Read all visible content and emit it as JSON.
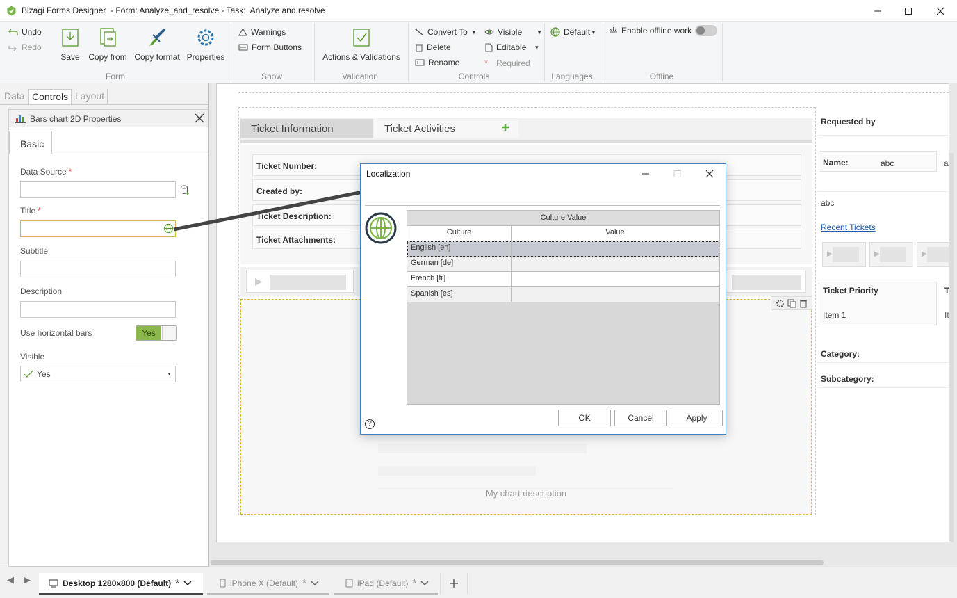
{
  "window": {
    "title": "Bizagi Forms Designer  - Form: Analyze_and_resolve - Task:  Analyze and resolve"
  },
  "ribbon": {
    "undo": "Undo",
    "redo": "Redo",
    "save": "Save",
    "copy_from": "Copy from",
    "copy_format": "Copy format",
    "properties": "Properties",
    "form_group": "Form",
    "warnings": "Warnings",
    "form_buttons": "Form Buttons",
    "show_group": "Show",
    "actions_validations": "Actions & Validations",
    "validation_group": "Validation",
    "convert_to": "Convert To",
    "delete": "Delete",
    "rename": "Rename",
    "visible": "Visible",
    "editable": "Editable",
    "required": "Required",
    "controls_group": "Controls",
    "language_default": "Default",
    "languages_group": "Languages",
    "enable_offline": "Enable offline work",
    "offline_group": "Offline"
  },
  "left_tabs": [
    "Data",
    "Controls",
    "Layout"
  ],
  "properties_panel": {
    "title": "Bars chart 2D Properties",
    "tab": "Basic",
    "data_source_label": "Data Source",
    "title_label": "Title",
    "subtitle_label": "Subtitle",
    "description_label": "Description",
    "horizontal_bars_label": "Use horizontal bars",
    "horizontal_bars_value": "Yes",
    "visible_label": "Visible",
    "visible_value": "Yes"
  },
  "form": {
    "tab_info": "Ticket Information",
    "tab_activities": "Ticket Activities",
    "ticket_number": "Ticket Number:",
    "created_by": "Created by:",
    "ticket_description": "Ticket Description:",
    "ticket_attachments": "Ticket Attachments:",
    "chart_description": "My chart description"
  },
  "right_column": {
    "requested_by": "Requested by",
    "name_label": "Name:",
    "name_value": "abc",
    "name_value_2": "a",
    "abc": "abc",
    "recent_tickets": "Recent Tickets",
    "ticket_priority": "Ticket Priority",
    "priority_item": "Item 1",
    "t_cut": "T",
    "it_cut": "It",
    "category": "Category:",
    "subcategory": "Subcategory:"
  },
  "dialog": {
    "title": "Localization",
    "grid_header": "Culture Value",
    "col_culture": "Culture",
    "col_value": "Value",
    "rows": [
      {
        "culture": "English [en]",
        "value": ""
      },
      {
        "culture": "German [de]",
        "value": ""
      },
      {
        "culture": "French [fr]",
        "value": ""
      },
      {
        "culture": "Spanish [es]",
        "value": ""
      }
    ],
    "ok": "OK",
    "cancel": "Cancel",
    "apply": "Apply",
    "help": "?"
  },
  "bottom_tabs": [
    {
      "label": "Desktop 1280x800 (Default)",
      "star": "*"
    },
    {
      "label": "iPhone X (Default)",
      "star": "*"
    },
    {
      "label": "iPad (Default)",
      "star": "*"
    }
  ],
  "colors": {
    "accent_green": "#7ab648",
    "dialog_border": "#3c82c4",
    "link_blue": "#1a5fb4"
  }
}
